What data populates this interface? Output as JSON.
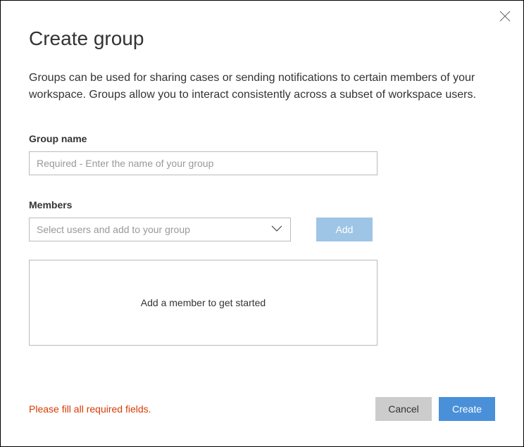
{
  "dialog": {
    "title": "Create group",
    "description": "Groups can be used for sharing cases or sending notifications to certain members of your workspace. Groups allow you to interact consistently across a subset of workspace users."
  },
  "groupName": {
    "label": "Group name",
    "placeholder": "Required - Enter the name of your group",
    "value": ""
  },
  "members": {
    "label": "Members",
    "selectPlaceholder": "Select users and add to your group",
    "addButton": "Add",
    "emptyText": "Add a member to get started"
  },
  "footer": {
    "errorMessage": "Please fill all required fields.",
    "cancelLabel": "Cancel",
    "createLabel": "Create"
  }
}
